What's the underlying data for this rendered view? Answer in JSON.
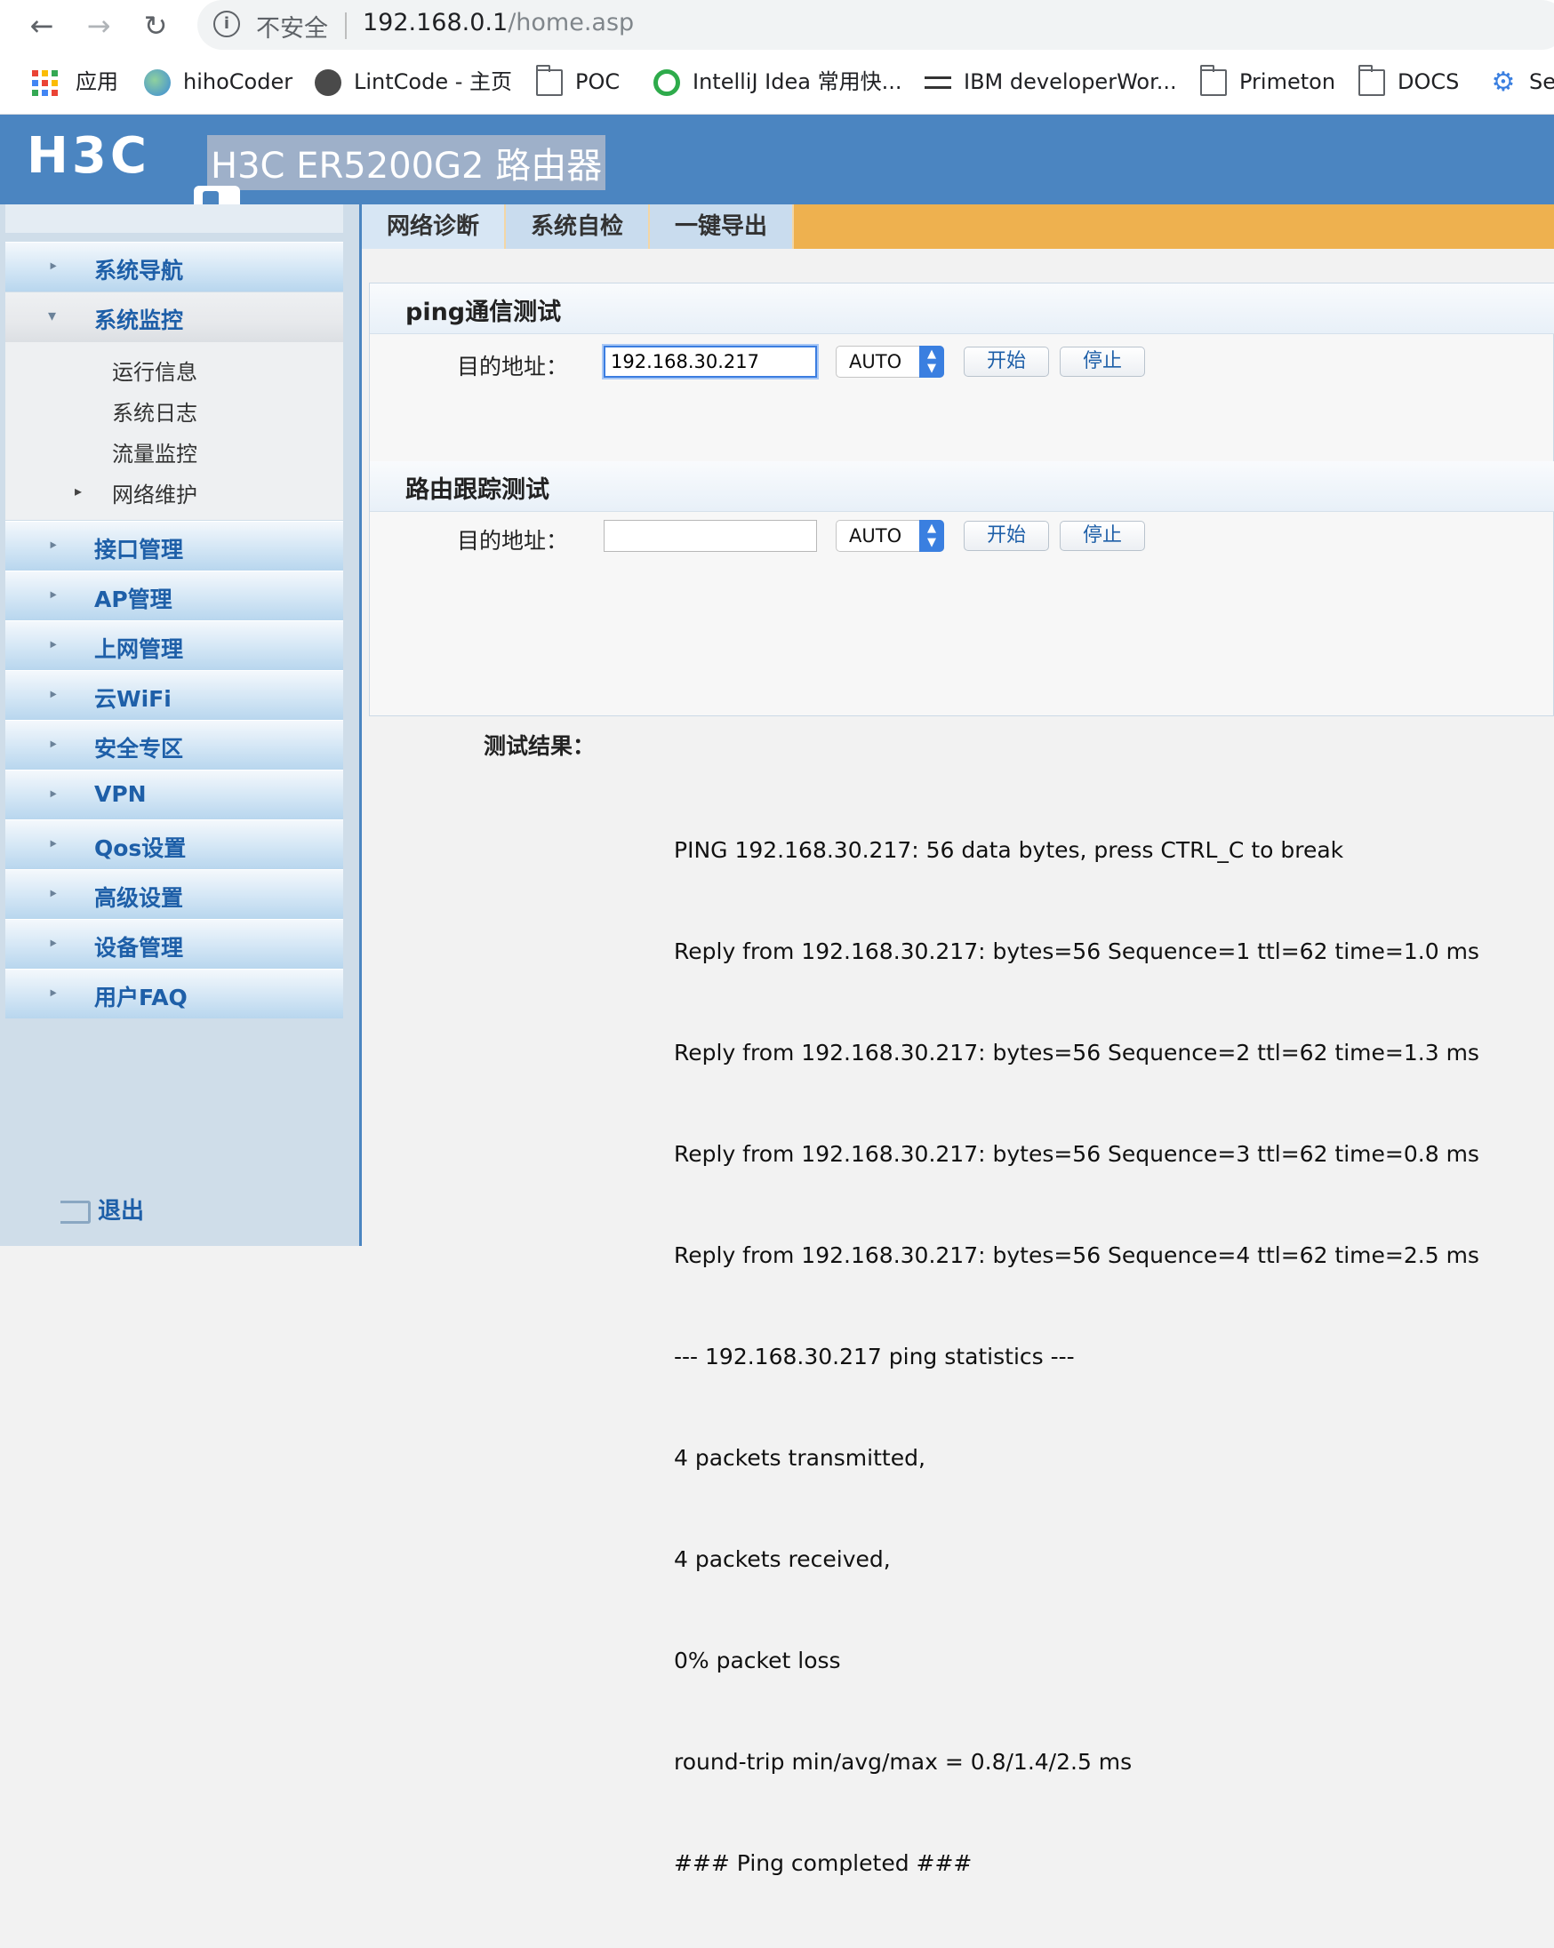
{
  "browser": {
    "security_label": "不安全",
    "url_host": "192.168.0.1",
    "url_path": "/home.asp",
    "bookmarks": [
      {
        "label": "应用",
        "icon": "apps-grid-icon"
      },
      {
        "label": "hihoCoder",
        "icon": "globe-icon"
      },
      {
        "label": "LintCode - 主页",
        "icon": "globe-icon"
      },
      {
        "label": "POC",
        "icon": "folder-icon"
      },
      {
        "label": "IntelliJ Idea 常用快...",
        "icon": "intellij-icon"
      },
      {
        "label": "IBM developerWor...",
        "icon": "ibm-icon"
      },
      {
        "label": "Primeton",
        "icon": "folder-icon"
      },
      {
        "label": "DOCS",
        "icon": "folder-icon"
      },
      {
        "label": "Se",
        "icon": "gear-icon"
      }
    ]
  },
  "header": {
    "logo": "H3C",
    "title": "H3C ER5200G2 路由器"
  },
  "sidebar": {
    "items": [
      {
        "label": "系统导航"
      },
      {
        "label": "系统监控",
        "expanded": true
      },
      {
        "label": "接口管理"
      },
      {
        "label": "AP管理"
      },
      {
        "label": "上网管理"
      },
      {
        "label": "云WiFi"
      },
      {
        "label": "安全专区"
      },
      {
        "label": "VPN"
      },
      {
        "label": "Qos设置"
      },
      {
        "label": "高级设置"
      },
      {
        "label": "设备管理"
      },
      {
        "label": "用户FAQ"
      }
    ],
    "subitems": [
      {
        "label": "运行信息"
      },
      {
        "label": "系统日志"
      },
      {
        "label": "流量监控"
      },
      {
        "label": "网络维护"
      }
    ],
    "logout": "退出"
  },
  "tabs": [
    {
      "label": "网络诊断",
      "active": true
    },
    {
      "label": "系统自检"
    },
    {
      "label": "一键导出"
    }
  ],
  "ping": {
    "title": "ping通信测试",
    "dest_label": "目的地址：",
    "dest_value": "192.168.30.217",
    "mode": "AUTO",
    "start": "开始",
    "stop": "停止"
  },
  "trace": {
    "title": "路由跟踪测试",
    "dest_label": "目的地址：",
    "dest_value": "",
    "mode": "AUTO",
    "start": "开始",
    "stop": "停止"
  },
  "result": {
    "title": "测试结果：",
    "lines": [
      "PING 192.168.30.217: 56 data bytes, press CTRL_C to break",
      "Reply from 192.168.30.217: bytes=56 Sequence=1 ttl=62 time=1.0 ms",
      "Reply from 192.168.30.217: bytes=56 Sequence=2 ttl=62 time=1.3 ms",
      "Reply from 192.168.30.217: bytes=56 Sequence=3 ttl=62 time=0.8 ms",
      "Reply from 192.168.30.217: bytes=56 Sequence=4 ttl=62 time=2.5 ms",
      "--- 192.168.30.217 ping statistics ---",
      "4 packets transmitted,",
      "4 packets received,",
      "0% packet loss",
      "round-trip min/avg/max = 0.8/1.4/2.5 ms",
      "### Ping completed ###"
    ]
  },
  "colors": {
    "header_blue": "#4b85c1",
    "tab_orange": "#eeb14f",
    "link_blue": "#1e5fa8"
  }
}
